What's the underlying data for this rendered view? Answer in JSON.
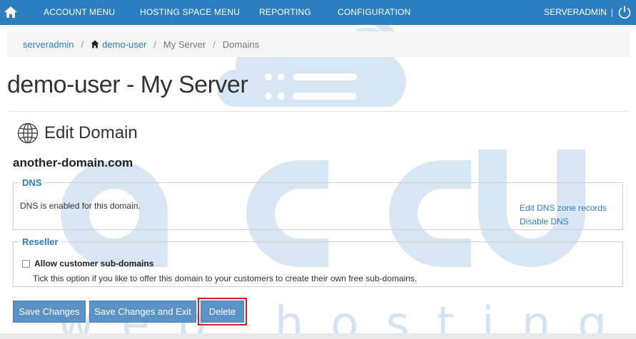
{
  "topbar": {
    "nav": [
      "ACCOUNT MENU",
      "HOSTING SPACE MENU",
      "REPORTING",
      "CONFIGURATION"
    ],
    "user": "SERVERADMIN",
    "separator": "|",
    "home_icon": "home-icon",
    "power_icon": "power-icon",
    "color": "#2b7fc0"
  },
  "breadcrumb": {
    "items": [
      "serveradmin",
      "demo-user",
      "My Server",
      "Domains"
    ],
    "separator": "/"
  },
  "page": {
    "title": "demo-user - My Server",
    "section_title": "Edit Domain",
    "domain": "another-domain.com"
  },
  "dns": {
    "legend": "DNS",
    "status_text": "DNS is enabled for this domain.",
    "links": [
      "Edit DNS zone records",
      "Disable DNS"
    ]
  },
  "reseller": {
    "legend": "Reseller",
    "checkbox_label": "Allow customer sub-domains",
    "checkbox_checked": false,
    "help": "Tick this option if you like to offer this domain to your customers to create their own free sub-domains."
  },
  "buttons": {
    "save": "Save Changes",
    "save_exit": "Save Changes and Exit",
    "delete": "Delete"
  },
  "watermark": {
    "logo": "cloud-logo",
    "text": "accu",
    "subtext": "web hosting"
  },
  "colors": {
    "accent": "#2b7fc0",
    "button": "#5b93c6",
    "highlight": "#d42020"
  }
}
